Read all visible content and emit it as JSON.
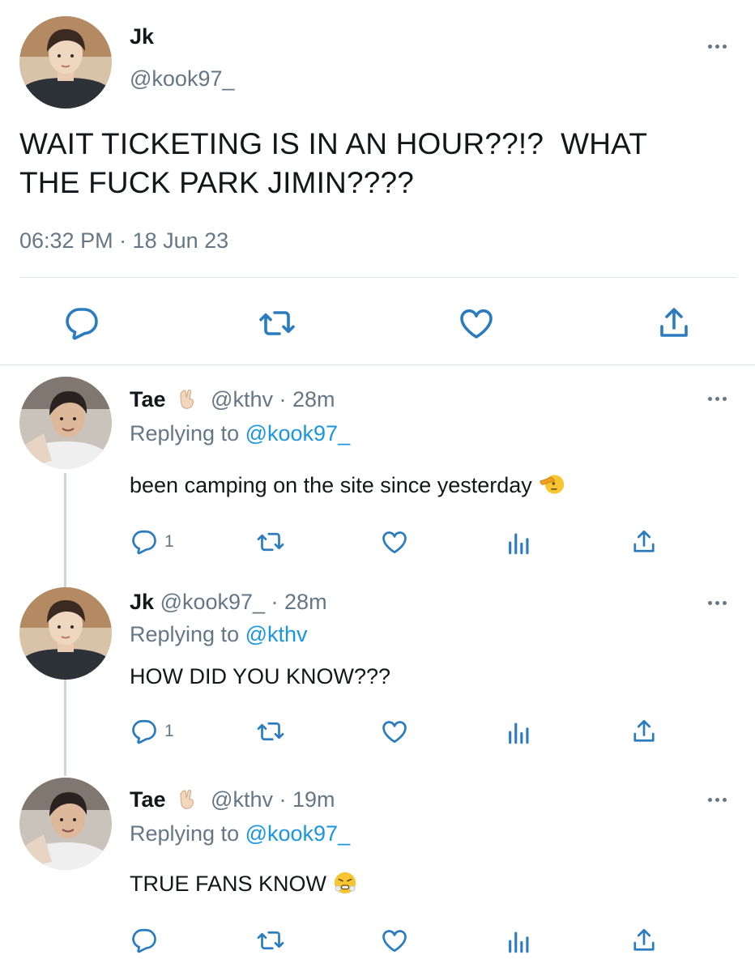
{
  "main_tweet": {
    "name": "Jk",
    "handle": "@kook97_",
    "text_line1": "WAIT TICKETING IS IN AN HOUR??!?  WHAT",
    "text_line2": "THE FUCK PARK JIMIN????",
    "timestamp": "06:32 PM · 18 Jun 23"
  },
  "replies": [
    {
      "name": "Tae",
      "badge_emoji": "peace-hand-emoji",
      "meta": "@kthv · 28m",
      "replying_prefix": "Replying to ",
      "replying_to": "@kook97_",
      "text": "been camping on the site since yesterday",
      "trailing_emoji": "saluting-face-emoji",
      "reply_count": "1"
    },
    {
      "name": "Jk",
      "meta": "@kook97_ · 28m",
      "replying_prefix": "Replying to ",
      "replying_to": "@kthv",
      "text": "HOW DID YOU KNOW???",
      "reply_count": "1"
    },
    {
      "name": "Tae",
      "badge_emoji": "peace-hand-emoji",
      "meta": "@kthv · 19m",
      "replying_prefix": "Replying to ",
      "replying_to": "@kook97_",
      "text": "TRUE FANS KNOW",
      "trailing_emoji": "steam-from-nose-emoji",
      "reply_count": ""
    }
  ],
  "colors": {
    "link": "#1b95e0",
    "secondary_text": "#657786",
    "icon": "#2a7bbf",
    "divider": "#e1e8ed"
  }
}
